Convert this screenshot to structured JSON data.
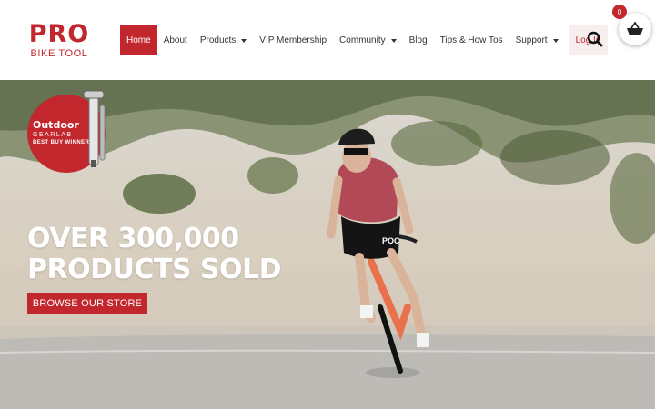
{
  "brand": {
    "name": "PRO",
    "subtitle": "BIKE TOOL",
    "accent": "#c1272d"
  },
  "nav": {
    "items": [
      {
        "label": "Home",
        "active": true,
        "dropdown": false
      },
      {
        "label": "About",
        "active": false,
        "dropdown": false
      },
      {
        "label": "Products",
        "active": false,
        "dropdown": true
      },
      {
        "label": "VIP Membership",
        "active": false,
        "dropdown": false
      },
      {
        "label": "Community",
        "active": false,
        "dropdown": true
      },
      {
        "label": "Blog",
        "active": false,
        "dropdown": false
      },
      {
        "label": "Tips & How Tos",
        "active": false,
        "dropdown": false
      },
      {
        "label": "Support",
        "active": false,
        "dropdown": true
      }
    ],
    "login_label": "Log In"
  },
  "header_icons": {
    "search": "search-icon",
    "cart": "basket-icon"
  },
  "cart": {
    "count": "0"
  },
  "hero": {
    "award": {
      "outdoor": "Outdoor",
      "gearlab": "GEARLAB",
      "best_buy": "BEST BUY WINNER"
    },
    "headline_line1": "OVER 300,000",
    "headline_line2": "PRODUCTS SOLD",
    "cta_label": "BROWSE OUR STORE",
    "jersey_text": "POC"
  }
}
